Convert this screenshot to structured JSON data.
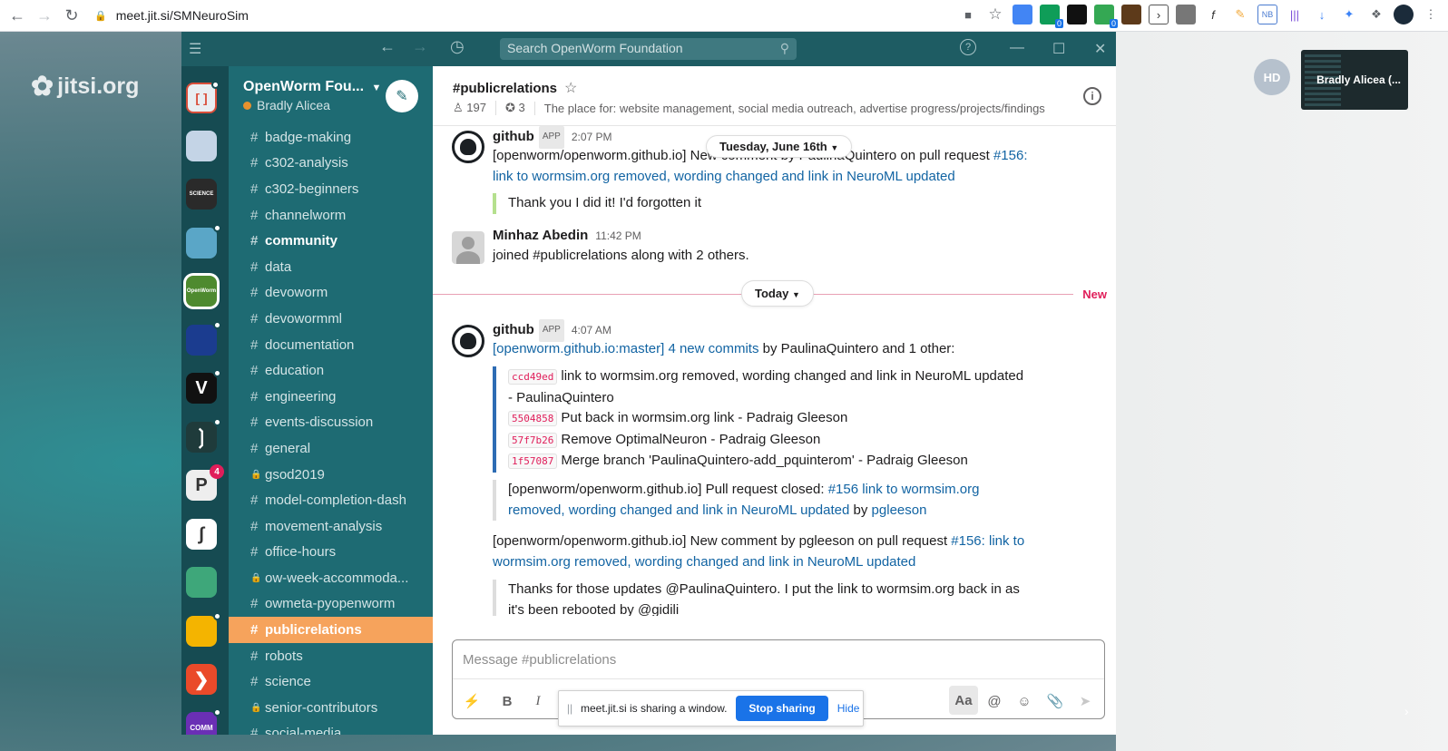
{
  "browser": {
    "url": "meet.jit.si/SMNeuroSim",
    "extension_badges": [
      "0",
      "0"
    ]
  },
  "jitsi": {
    "logo_text": "jitsi.org",
    "participant_initials": "HD",
    "thumbnail_name": "Bradly Alicea (...",
    "share_bar": {
      "message": "meet.jit.si is sharing a window.",
      "stop_label": "Stop sharing",
      "hide_label": "Hide"
    }
  },
  "slack": {
    "search_placeholder": "Search OpenWorm Foundation",
    "workspace": {
      "name": "OpenWorm Fou...",
      "user": "Bradly Alicea"
    },
    "rail_badge": "4",
    "channels": [
      {
        "name": "badge-making",
        "type": "public",
        "state": "normal"
      },
      {
        "name": "c302-analysis",
        "type": "public",
        "state": "normal"
      },
      {
        "name": "c302-beginners",
        "type": "public",
        "state": "normal"
      },
      {
        "name": "channelworm",
        "type": "public",
        "state": "normal"
      },
      {
        "name": "community",
        "type": "public",
        "state": "unread"
      },
      {
        "name": "data",
        "type": "public",
        "state": "normal"
      },
      {
        "name": "devoworm",
        "type": "public",
        "state": "normal"
      },
      {
        "name": "devowormml",
        "type": "public",
        "state": "normal"
      },
      {
        "name": "documentation",
        "type": "public",
        "state": "normal"
      },
      {
        "name": "education",
        "type": "public",
        "state": "normal"
      },
      {
        "name": "engineering",
        "type": "public",
        "state": "normal"
      },
      {
        "name": "events-discussion",
        "type": "public",
        "state": "normal"
      },
      {
        "name": "general",
        "type": "public",
        "state": "normal"
      },
      {
        "name": "gsod2019",
        "type": "private",
        "state": "normal"
      },
      {
        "name": "model-completion-dash",
        "type": "public",
        "state": "normal"
      },
      {
        "name": "movement-analysis",
        "type": "public",
        "state": "normal"
      },
      {
        "name": "office-hours",
        "type": "public",
        "state": "normal"
      },
      {
        "name": "ow-week-accommoda...",
        "type": "private",
        "state": "normal"
      },
      {
        "name": "owmeta-pyopenworm",
        "type": "public",
        "state": "normal"
      },
      {
        "name": "publicrelations",
        "type": "public",
        "state": "active"
      },
      {
        "name": "robots",
        "type": "public",
        "state": "normal"
      },
      {
        "name": "science",
        "type": "public",
        "state": "normal"
      },
      {
        "name": "senior-contributors",
        "type": "private",
        "state": "normal"
      },
      {
        "name": "social-media",
        "type": "public",
        "state": "normal"
      }
    ],
    "channel_header": {
      "title": "#publicrelations",
      "members": "197",
      "pins": "3",
      "topic": "The place for: website management, social media outreach, advertise progress/projects/findings"
    },
    "messages": {
      "m1": {
        "sender": "github",
        "tag": "APP",
        "time": "2:07 PM",
        "text_a": "[openworm/openworm.github.io] New comment by PaulinaQuintero on pull request ",
        "link_a": "#156:",
        "link_b": "link to wormsim.org removed, wording changed and link in NeuroML updated",
        "quote": "Thank you I did it! I'd forgotten it"
      },
      "date_pill_1": "Tuesday, June 16th",
      "m2": {
        "sender": "Minhaz Abedin",
        "time": "11:42 PM",
        "text": "joined #publicrelations along with 2 others."
      },
      "date_pill_2": "Today",
      "new_label": "New",
      "m3": {
        "sender": "github",
        "tag": "APP",
        "time": "4:07 AM",
        "repo_link": "[openworm.github.io:master]",
        "commits_link": "4 new commits",
        "commits_by": " by PaulinaQuintero and 1 other:",
        "commits": [
          {
            "sha": "ccd49ed",
            "msg": "link to wormsim.org removed, wording changed and link in NeuroML updated",
            "msg2": "- PaulinaQuintero"
          },
          {
            "sha": "5504858",
            "msg": "Put back in wormsim.org link - Padraig  Gleeson"
          },
          {
            "sha": "57f7b26",
            "msg": "Remove OptimalNeuron - Padraig  Gleeson"
          },
          {
            "sha": "1f57087",
            "msg": "Merge branch 'PaulinaQuintero-add_pquinterom' - Padraig  Gleeson"
          }
        ],
        "pr_closed_a": "[openworm/openworm.github.io] Pull request closed: ",
        "pr_closed_link1": "#156 link to wormsim.org",
        "pr_closed_link2": "removed, wording changed and link in NeuroML updated",
        "pr_closed_by": " by ",
        "pr_closed_user": "pgleeson",
        "comment_a": "[openworm/openworm.github.io] New comment by pgleeson on pull request ",
        "comment_link1": "#156: link to",
        "comment_link2": "wormsim.org removed, wording changed and link in NeuroML updated",
        "quote_line1": "Thanks for those updates @PaulinaQuintero. I put the link to wormsim.org back in as",
        "quote_line2": "it's been rebooted by @gidili"
      }
    },
    "composer": {
      "placeholder": "Message #publicrelations",
      "bold": "B",
      "italic": "I",
      "format": "Aa",
      "mention": "@"
    }
  },
  "colors": {
    "titlebar": "#1e5c63",
    "sidebar": "#1e6b73",
    "rail": "#164b52",
    "active_channel": "#f6a35c",
    "link": "#1264a3",
    "new_marker": "#e01e5a",
    "stop_button": "#1a73e8"
  }
}
